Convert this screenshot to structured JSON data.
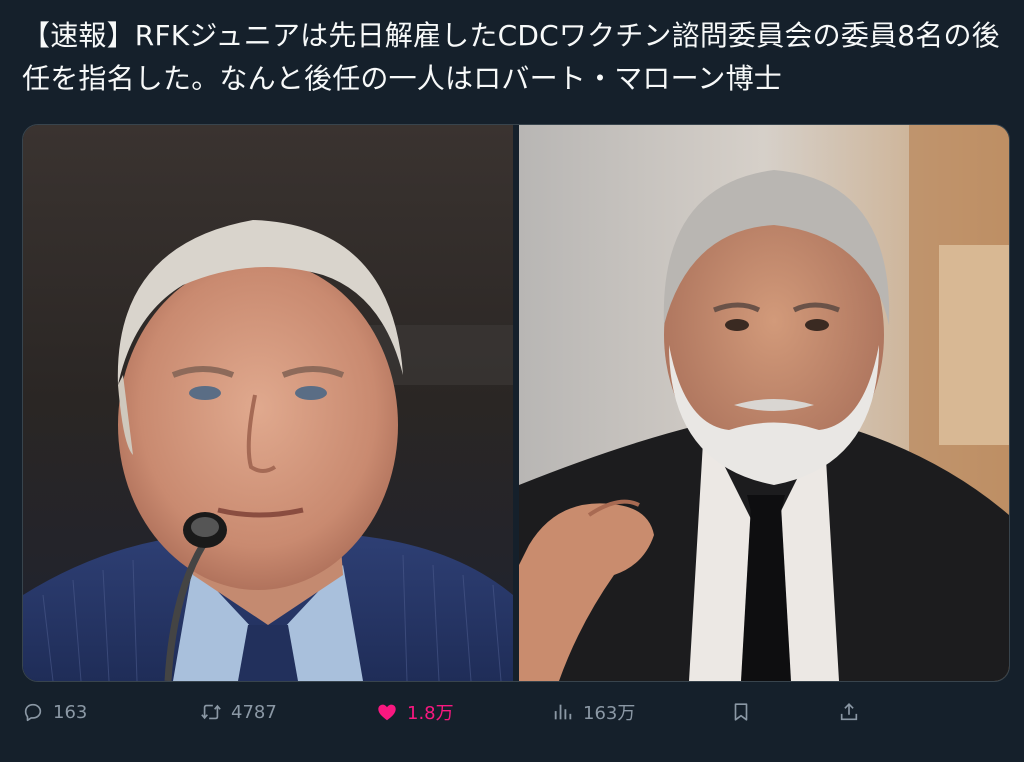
{
  "tweet": {
    "text": "【速報】RFKジュニアは先日解雇したCDCワクチン諮問委員会の委員8名の後任を指名した。なんと後任の一人はロバート・マローン博士"
  },
  "media": {
    "photos": [
      {
        "subject": "man in blue suit at microphone"
      },
      {
        "subject": "bearded man in black suit gesturing"
      }
    ]
  },
  "actions": {
    "reply": {
      "icon": "reply-icon",
      "count": "163"
    },
    "retweet": {
      "icon": "retweet-icon",
      "count": "4787"
    },
    "like": {
      "icon": "heart-icon",
      "count": "1.8万",
      "color": "#f91880",
      "liked": true
    },
    "views": {
      "icon": "views-icon",
      "count": "163万"
    },
    "bookmark": {
      "icon": "bookmark-icon"
    },
    "share": {
      "icon": "share-icon"
    }
  },
  "colors": {
    "background": "#15202b",
    "text": "#f7f9f9",
    "muted": "#8b98a5",
    "like": "#f91880"
  }
}
